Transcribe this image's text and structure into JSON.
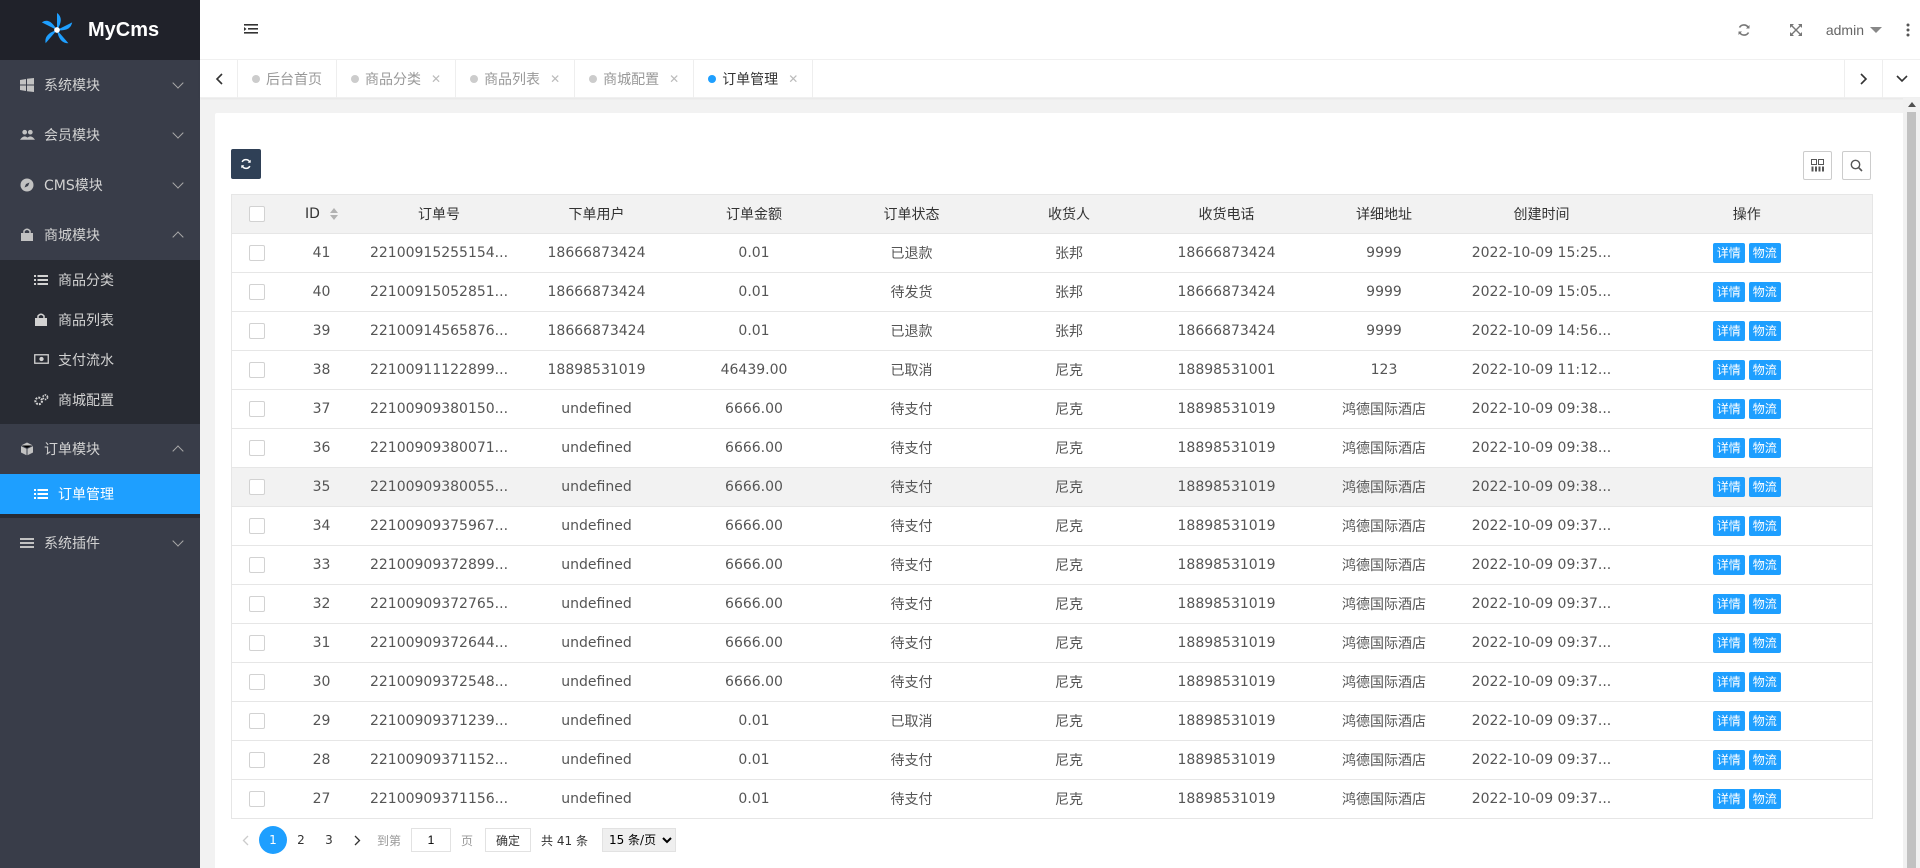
{
  "app": {
    "name": "MyCms"
  },
  "header": {
    "user": "admin"
  },
  "sidebar": {
    "items": [
      {
        "label": "系统模块",
        "expanded": false,
        "icon": "windows-icon"
      },
      {
        "label": "会员模块",
        "expanded": false,
        "icon": "users-icon"
      },
      {
        "label": "CMS模块",
        "expanded": false,
        "icon": "compass-icon"
      },
      {
        "label": "商城模块",
        "expanded": true,
        "icon": "shopping-bag-icon",
        "children": [
          {
            "label": "商品分类",
            "icon": "list-icon"
          },
          {
            "label": "商品列表",
            "icon": "shopping-bag-icon"
          },
          {
            "label": "支付流水",
            "icon": "money-icon"
          },
          {
            "label": "商城配置",
            "icon": "cogs-icon"
          }
        ]
      },
      {
        "label": "订单模块",
        "expanded": true,
        "icon": "cube-icon",
        "children": [
          {
            "label": "订单管理",
            "icon": "list-icon",
            "active": true
          }
        ]
      },
      {
        "label": "系统插件",
        "expanded": false,
        "icon": "bars-icon"
      }
    ]
  },
  "tabs": [
    {
      "label": "后台首页",
      "closable": false,
      "active": false
    },
    {
      "label": "商品分类",
      "closable": true,
      "active": false
    },
    {
      "label": "商品列表",
      "closable": true,
      "active": false
    },
    {
      "label": "商城配置",
      "closable": true,
      "active": false
    },
    {
      "label": "订单管理",
      "closable": true,
      "active": true
    }
  ],
  "table": {
    "columns": [
      "ID",
      "订单号",
      "下单用户",
      "订单金额",
      "订单状态",
      "收货人",
      "收货电话",
      "详细地址",
      "创建时间",
      "操作"
    ],
    "action_detail": "详情",
    "action_logistics": "物流",
    "rows": [
      [
        "41",
        "22100915255154...",
        "18666873424",
        "0.01",
        "已退款",
        "张邦",
        "18666873424",
        "9999",
        "2022-10-09 15:25..."
      ],
      [
        "40",
        "22100915052851...",
        "18666873424",
        "0.01",
        "待发货",
        "张邦",
        "18666873424",
        "9999",
        "2022-10-09 15:05..."
      ],
      [
        "39",
        "22100914565876...",
        "18666873424",
        "0.01",
        "已退款",
        "张邦",
        "18666873424",
        "9999",
        "2022-10-09 14:56..."
      ],
      [
        "38",
        "22100911122899...",
        "18898531019",
        "46439.00",
        "已取消",
        "尼克",
        "18898531001",
        "123",
        "2022-10-09 11:12..."
      ],
      [
        "37",
        "22100909380150...",
        "undefined",
        "6666.00",
        "待支付",
        "尼克",
        "18898531019",
        "鸿德国际酒店",
        "2022-10-09 09:38..."
      ],
      [
        "36",
        "22100909380071...",
        "undefined",
        "6666.00",
        "待支付",
        "尼克",
        "18898531019",
        "鸿德国际酒店",
        "2022-10-09 09:38..."
      ],
      [
        "35",
        "22100909380055...",
        "undefined",
        "6666.00",
        "待支付",
        "尼克",
        "18898531019",
        "鸿德国际酒店",
        "2022-10-09 09:38..."
      ],
      [
        "34",
        "22100909375967...",
        "undefined",
        "6666.00",
        "待支付",
        "尼克",
        "18898531019",
        "鸿德国际酒店",
        "2022-10-09 09:37..."
      ],
      [
        "33",
        "22100909372899...",
        "undefined",
        "6666.00",
        "待支付",
        "尼克",
        "18898531019",
        "鸿德国际酒店",
        "2022-10-09 09:37..."
      ],
      [
        "32",
        "22100909372765...",
        "undefined",
        "6666.00",
        "待支付",
        "尼克",
        "18898531019",
        "鸿德国际酒店",
        "2022-10-09 09:37..."
      ],
      [
        "31",
        "22100909372644...",
        "undefined",
        "6666.00",
        "待支付",
        "尼克",
        "18898531019",
        "鸿德国际酒店",
        "2022-10-09 09:37..."
      ],
      [
        "30",
        "22100909372548...",
        "undefined",
        "6666.00",
        "待支付",
        "尼克",
        "18898531019",
        "鸿德国际酒店",
        "2022-10-09 09:37..."
      ],
      [
        "29",
        "22100909371239...",
        "undefined",
        "0.01",
        "已取消",
        "尼克",
        "18898531019",
        "鸿德国际酒店",
        "2022-10-09 09:37..."
      ],
      [
        "28",
        "22100909371152...",
        "undefined",
        "0.01",
        "待支付",
        "尼克",
        "18898531019",
        "鸿德国际酒店",
        "2022-10-09 09:37..."
      ],
      [
        "27",
        "22100909371156...",
        "undefined",
        "0.01",
        "待支付",
        "尼克",
        "18898531019",
        "鸿德国际酒店",
        "2022-10-09 09:37..."
      ]
    ],
    "highlighted_row": 6
  },
  "pagination": {
    "pages": [
      "1",
      "2",
      "3"
    ],
    "current": "1",
    "goto_label": "到第",
    "goto_value": "1",
    "page_unit": "页",
    "confirm_label": "确定",
    "total_label": "共 41 条",
    "page_size_options": [
      "15 条/页"
    ],
    "page_size": "15 条/页"
  },
  "colors": {
    "accent": "#1e9fff",
    "sidebar_bg": "#393d49",
    "sidebar_dark": "#282b33",
    "logo_bg": "#20222a",
    "refresh_btn": "#2f4056"
  }
}
